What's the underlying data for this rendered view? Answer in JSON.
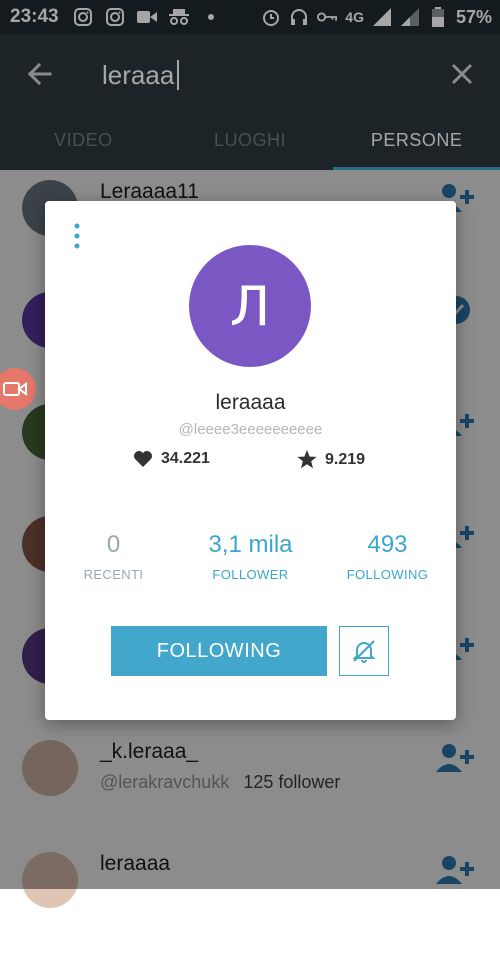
{
  "status_bar": {
    "time": "23:43",
    "network": "4G",
    "battery": "57%"
  },
  "search": {
    "query": "leraaa"
  },
  "tabs": [
    {
      "label": "VIDEO"
    },
    {
      "label": "LUOGHI"
    },
    {
      "label": "PERSONE",
      "active": true
    }
  ],
  "results": [
    {
      "name": "Leraaaa11",
      "handle": "",
      "followers": ""
    },
    {
      "name": "",
      "handle": "",
      "followers": ""
    },
    {
      "name": "",
      "handle": "",
      "followers": ""
    },
    {
      "name": "",
      "handle": "",
      "followers": ""
    },
    {
      "name": "",
      "handle": "",
      "followers": ""
    },
    {
      "name": "_k.leraaa_",
      "handle": "@lerakravchukk",
      "followers": "125 follower"
    },
    {
      "name": "leraaaa",
      "handle": "",
      "followers": ""
    }
  ],
  "profile": {
    "avatar_letter": "Л",
    "name": "leraaaa",
    "handle": "@leeee3eeeeeeeeee",
    "hearts": "34.221",
    "stars": "9.219",
    "stats": [
      {
        "value": "0",
        "label": "RECENTI"
      },
      {
        "value": "3,1 mila",
        "label": "FOLLOWER"
      },
      {
        "value": "493",
        "label": "FOLLOWING"
      }
    ],
    "follow_button": "FOLLOWING"
  },
  "colors": {
    "header": "#2c383c",
    "accent": "#42a7ca",
    "avatar": "#7b57c4"
  }
}
